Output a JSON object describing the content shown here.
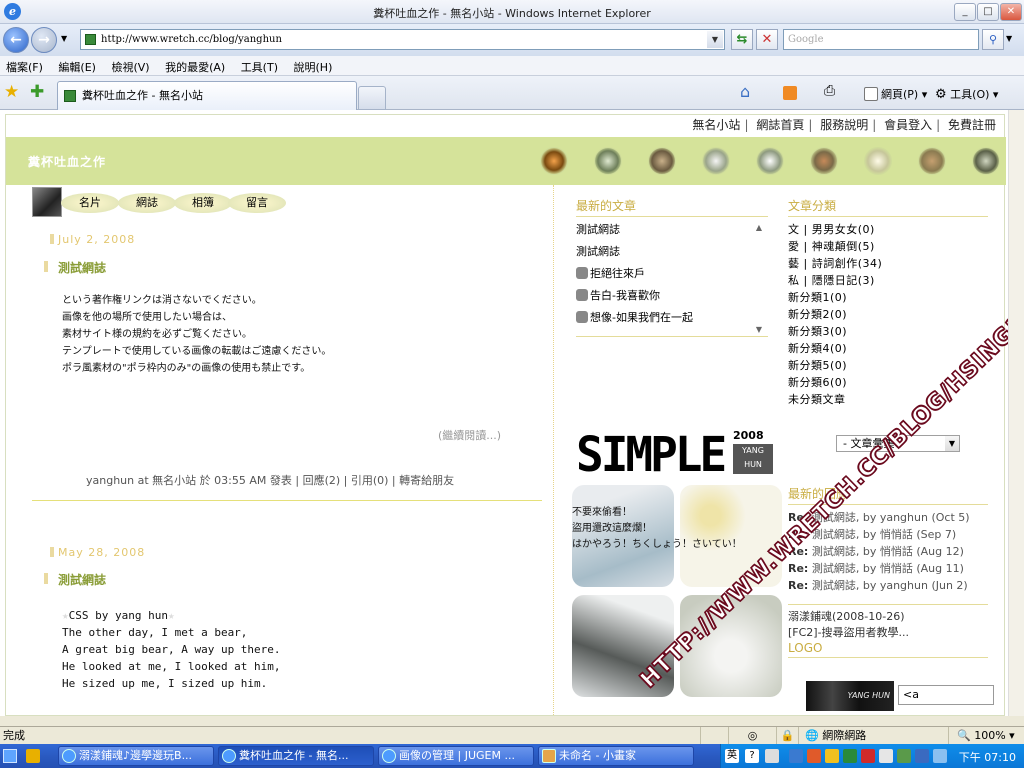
{
  "window": {
    "title": "糞杯吐血之作 - 無名小站 - Windows Internet Explorer"
  },
  "address": {
    "url": "http://www.wretch.cc/blog/yanghun",
    "search_placeholder": "Google"
  },
  "menu": [
    "檔案(F)",
    "編輯(E)",
    "檢視(V)",
    "我的最愛(A)",
    "工具(T)",
    "說明(H)"
  ],
  "tab": {
    "label": "糞杯吐血之作 - 無名小站"
  },
  "tools": {
    "page": "網頁(P)",
    "tools": "工具(O)"
  },
  "topnav": [
    "無名小站",
    "網誌首頁",
    "服務說明",
    "會員登入",
    "免費註冊"
  ],
  "site": {
    "name": "糞杯吐血之作"
  },
  "nav": [
    "名片",
    "網誌",
    "相簿",
    "留言"
  ],
  "post1": {
    "date": "July 2, 2008",
    "title": "測試網誌",
    "lines": [
      "という著作権リンクは消さないでください。",
      "画像を他の場所で使用したい場合は、",
      "素材サイト様の規約を必ずご覧ください。",
      "テンプレートで使用している画像の転載はご遠慮ください。",
      "ポラ風素材の\"ポラ枠内のみ\"の画像の使用も禁止です。"
    ],
    "readmore": "(繼續閱讀...)",
    "footer": "yanghun at 無名小站 於 03:55 AM 發表 | 回應(2) | 引用(0) | 轉寄給朋友"
  },
  "post2": {
    "date": "May 28, 2008",
    "title": "測試網誌",
    "lines": [
      "CSS by yang hun",
      "The other day, I met a bear,",
      "A great big bear, A way up there.",
      "He looked at me, I looked at him,",
      "He sized up me, I sized up him."
    ]
  },
  "recent": {
    "heading": "最新的文章",
    "items": [
      "測試網誌",
      "測試網誌",
      "拒絕往來戶",
      "告白-我喜歡你",
      "想像-如果我們在一起"
    ]
  },
  "logo": {
    "big": "SIMPLE",
    "year": "2008",
    "name1": "YANG",
    "name2": "HUN"
  },
  "photo_text": [
    "不要來偷看！",
    "盜用還改這麼爛！",
    "はかやろう！ちくしょう！さいてい！"
  ],
  "categories": {
    "heading": "文章分類",
    "items": [
      "文 | 男男女女(0)",
      "愛 | 神魂顛倒(5)",
      "藝 | 詩詞創作(34)",
      "私 | 隱隱日記(3)",
      "新分類1(0)",
      "新分類2(0)",
      "新分類3(0)",
      "新分類4(0)",
      "新分類5(0)",
      "新分類6(0)",
      "未分類文章"
    ]
  },
  "archive": {
    "label": "- 文章彙集 -"
  },
  "replies": {
    "heading": "最新的回應",
    "items": [
      {
        "re": "Re:",
        "text": "測試網誌, by yanghun (Oct 5)"
      },
      {
        "re": "Re:",
        "text": "測試網誌, by 悄悄話 (Sep 7)"
      },
      {
        "re": "Re:",
        "text": "測試網誌, by 悄悄話 (Aug 12)"
      },
      {
        "re": "Re:",
        "text": "測試網誌, by 悄悄話 (Aug 11)"
      },
      {
        "re": "Re:",
        "text": "測試網誌, by yanghun (Jun 2)"
      }
    ]
  },
  "trackbacks": [
    "溺漾鋪魂(2008-10-26)",
    "[FC2]-搜尋盜用者教學..."
  ],
  "logo_section": {
    "heading": "LOGO",
    "image_text": "YANG HUN",
    "input_value": "<a"
  },
  "watermark": "HTTP://WWW.WRETCH.CC/BLOG/HSING1988",
  "status": {
    "text": "完成",
    "zone": "網際網路",
    "zoom": "100%"
  },
  "taskbar": {
    "items": [
      "溺漾鋪魂♪邊學邊玩B...",
      "糞杯吐血之作 - 無名...",
      "画像の管理 | JUGEM ...",
      "未命名 - 小畫家"
    ],
    "clock": "下午 07:10"
  }
}
